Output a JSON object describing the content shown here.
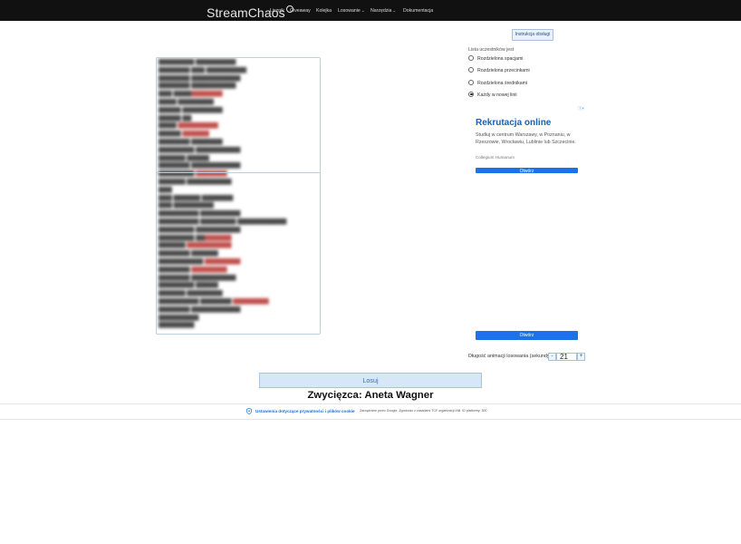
{
  "nav": {
    "logo": "StreamChaos",
    "items": [
      {
        "label": "Licznik",
        "has_dropdown": false
      },
      {
        "label": "Giveaway",
        "has_dropdown": false
      },
      {
        "label": "Kolejka",
        "has_dropdown": false
      },
      {
        "label": "Losowanie",
        "has_dropdown": true
      },
      {
        "label": "Narzędzia",
        "has_dropdown": true
      },
      {
        "label": "Dokumentacja",
        "has_dropdown": false
      }
    ]
  },
  "help_button": "Instrukcja obsługi",
  "separator": {
    "label": "Lista uczestników jest",
    "options": [
      {
        "label": "Rozdzielona spacjami",
        "selected": false
      },
      {
        "label": "Rozdzielona przecinkami",
        "selected": false
      },
      {
        "label": "Rozdzielona średnikami",
        "selected": false
      },
      {
        "label": "Każdy w nowej linii",
        "selected": true
      }
    ]
  },
  "ad": {
    "title": "Rekrutacja online",
    "text": "Studiuj w centrum Warszawy, w Poznaniu, w Rzeszowie, Wrocławiu, Lublinie lub Szczecinie.",
    "brand": "Collegium Humanum",
    "button": "Otwórz"
  },
  "duration": {
    "label": "Długość animacji losowania (sekundy):",
    "value": "21",
    "minus": "-",
    "plus": "+"
  },
  "draw_button": "Losuj",
  "winner": "Zwycięzca: Aneta Wagner",
  "footer": {
    "privacy": "Ustawienia dotyczące prywatności i plików cookie",
    "google": "Zarządzane przez Google. Zgodność z zasadami TCF organizacji IAB. ID platformy: 300"
  },
  "colors": {
    "navbar": "#111111",
    "accent": "#1a73e8",
    "draw_button_bg": "#d6e8f8"
  }
}
